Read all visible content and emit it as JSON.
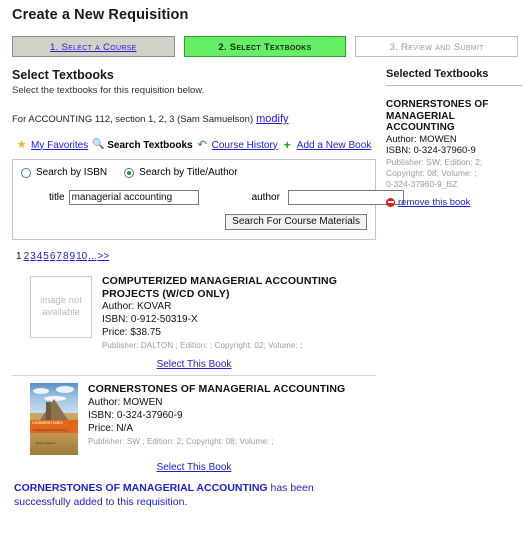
{
  "page": {
    "title": "Create a New Requisition"
  },
  "steps": [
    {
      "label": "1. Select a Course",
      "state": "done"
    },
    {
      "label": "2. Select Textbooks",
      "state": "current"
    },
    {
      "label": "3. Review and Submit",
      "state": "future"
    }
  ],
  "main": {
    "section_title": "Select Textbooks",
    "section_sub": "Select the textbooks for this requisition below.",
    "course_text": "For ACCOUNTING 112, section 1, 2, 3 (Sam Samuelson)",
    "modify_label": "modify",
    "nav": [
      {
        "icon": "star-icon",
        "label": "My Favorites",
        "active": false
      },
      {
        "icon": "magnifier-icon",
        "label": "Search Textbooks",
        "active": true
      },
      {
        "icon": "history-icon",
        "label": "Course History",
        "active": false
      },
      {
        "icon": "plus-icon",
        "label": "Add a New Book",
        "active": false
      }
    ],
    "search": {
      "radio_isbn_label": "Search by ISBN",
      "radio_title_label": "Search by Title/Author",
      "selected_radio": "title_author",
      "title_label": "title",
      "title_value": "managerial accounting",
      "author_label": "author",
      "author_value": "",
      "submit_label": "Search For Course Materials"
    },
    "pager": {
      "current": "1",
      "pages": [
        "2",
        "3",
        "4",
        "5",
        "6",
        "7",
        "8",
        "9",
        "10"
      ],
      "ellipsis": "...",
      "next": ">>"
    },
    "results": [
      {
        "thumb": "image not available",
        "title": "COMPUTERIZED MANAGERIAL ACCOUNTING PROJECTS (W/CD ONLY)",
        "author": "Author: KOVAR",
        "isbn": "ISBN: 0-912-50319-X",
        "price": "Price: $38.75",
        "publisher": "Publisher: DALTON ; Edition: ; Copyright: 02; Volume: ;",
        "select_label": "Select This Book"
      },
      {
        "thumb": "cover",
        "cover_title": "CORNERSTONES",
        "cover_sub": "of Managerial Accounting",
        "cover_author": "Mowen  Hansen",
        "title": "CORNERSTONES OF MANAGERIAL ACCOUNTING",
        "author": "Author: MOWEN",
        "isbn": "ISBN: 0-324-37960-9",
        "price": "Price: N/A",
        "publisher": "Publisher: SW ; Edition: 2; Copyright: 08; Volume: ;",
        "select_label": "Select This Book"
      }
    ],
    "notice": {
      "book": "CORNERSTONES OF MANAGERIAL ACCOUNTING",
      "text": " has been successfully added to this requisition."
    }
  },
  "sidebar": {
    "title": "Selected Textbooks",
    "book": {
      "title": "CORNERSTONES OF MANAGERIAL ACCOUNTING",
      "author": "Author: MOWEN",
      "isbn": "ISBN: 0-324-37960-9",
      "pub1": "Publisher: SW; Edition: 2;",
      "pub2": "Copyright: 08; Volume: ;",
      "pub3": "0-324-37960-9_BZ",
      "remove_label": "remove this book"
    }
  },
  "colors": {
    "link": "#2222cc",
    "current_step": "#66ee66",
    "done_step": "#d4d0c8",
    "remove": "#d81f1f",
    "star": "#f5b21a"
  }
}
